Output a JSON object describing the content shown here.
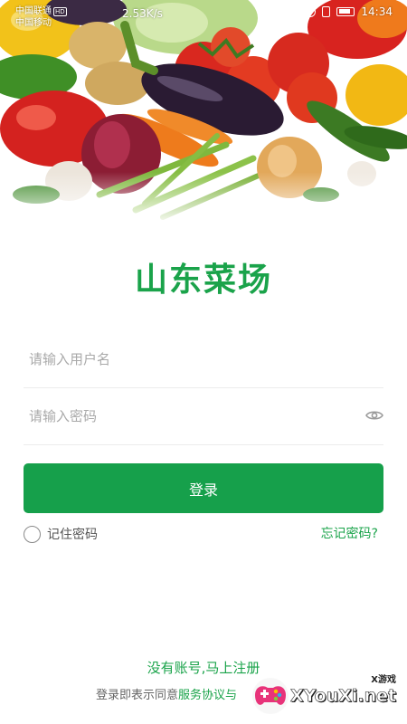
{
  "status_bar": {
    "carrier_primary": "中国联通",
    "carrier_primary_badge": "HD",
    "carrier_secondary": "中国移动",
    "network_speed": "2.53K/s",
    "time": "14:34"
  },
  "app": {
    "title": "山东菜场"
  },
  "form": {
    "username_placeholder": "请输入用户名",
    "password_placeholder": "请输入密码",
    "login_label": "登录",
    "remember_label": "记住密码",
    "remember_checked": false,
    "forgot_label": "忘记密码?"
  },
  "footer": {
    "register_label": "没有账号,马上注册",
    "agreement_prefix": "登录即表示同意",
    "service_link": "服务协议",
    "agreement_connector": "与"
  },
  "watermark": {
    "brand": "XYouXi.net",
    "tag": "X游戏"
  },
  "colors": {
    "accent": "#16a04b",
    "link": "#1aa34a",
    "placeholder": "#a9a9a9"
  },
  "icons": {
    "password_toggle": "eye-icon",
    "remember": "radio-circle-icon"
  }
}
